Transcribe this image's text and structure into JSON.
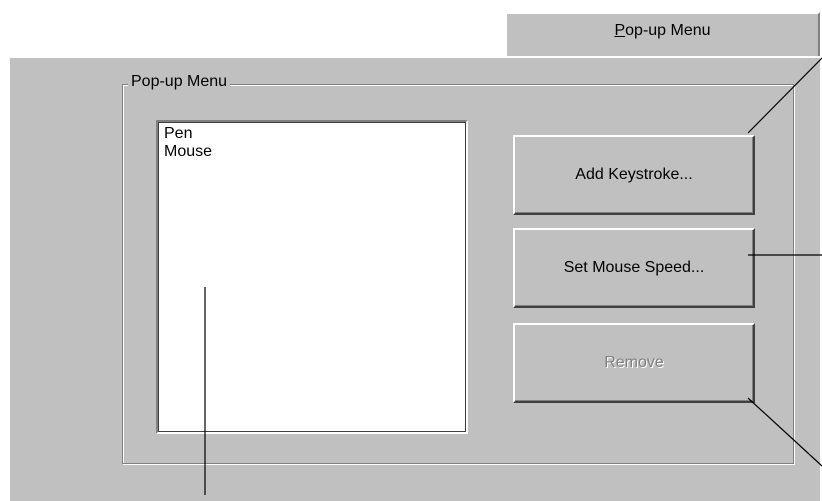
{
  "tab": {
    "mnemonic": "P",
    "label_rest": "op-up Menu"
  },
  "group": {
    "label": "Pop-up Menu"
  },
  "list": {
    "items": [
      "Pen",
      "Mouse"
    ]
  },
  "buttons": {
    "add_keystroke": "Add Keystroke...",
    "set_mouse_speed": "Set Mouse Speed...",
    "remove": "Remove"
  },
  "colors": {
    "face": "#c0c0c0",
    "disabled_text": "#808080"
  }
}
